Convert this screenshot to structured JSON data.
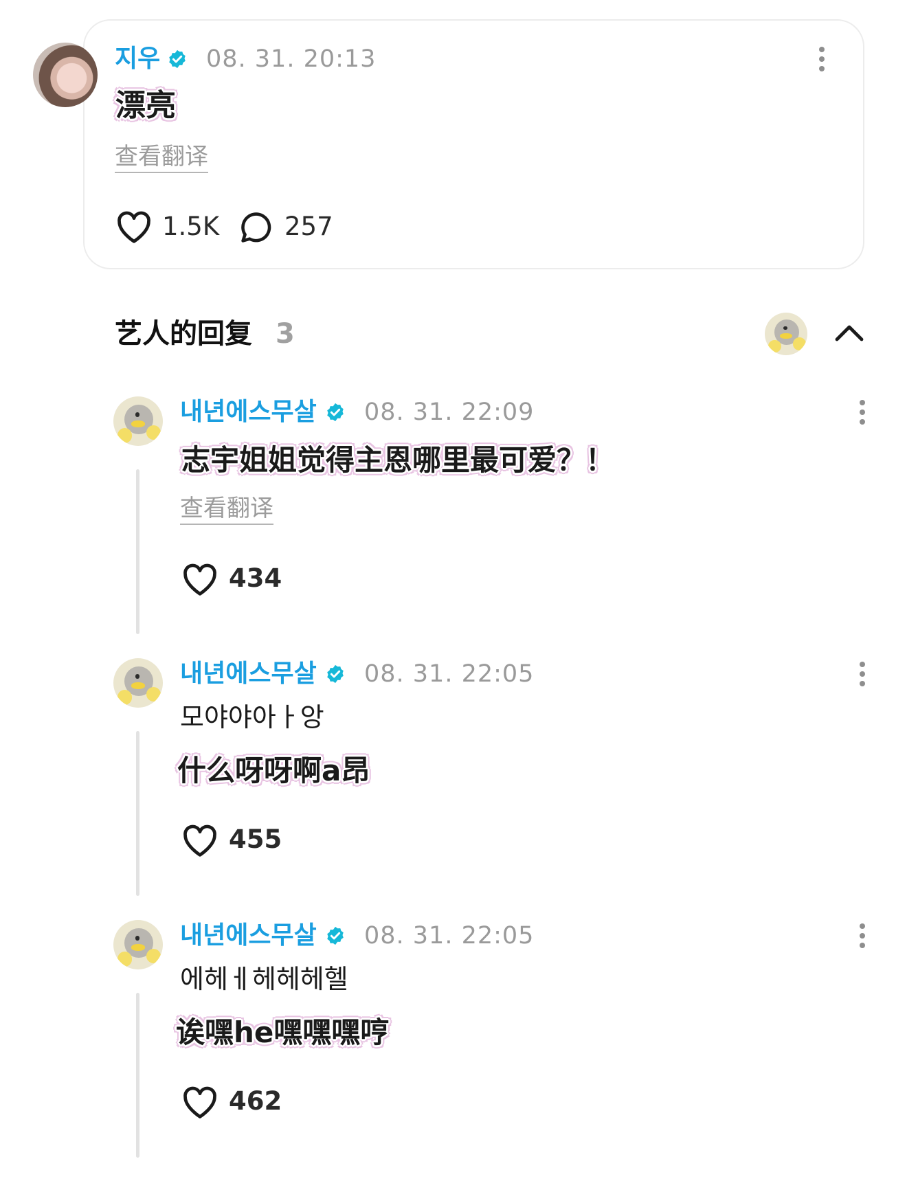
{
  "main_comment": {
    "author": "지우",
    "time": "08. 31. 20:13",
    "text": "漂亮",
    "translate_label": "查看翻译",
    "likes": "1.5K",
    "replies_count": "257"
  },
  "replies_section": {
    "title": "艺人的回复",
    "count": "3"
  },
  "replies": [
    {
      "author": "내년에스무살",
      "time": "08. 31. 22:09",
      "text": "",
      "caption": "志宇姐姐觉得主恩哪里最可爱？！",
      "translate_label": "查看翻译",
      "likes": "434"
    },
    {
      "author": "내년에스무살",
      "time": "08. 31. 22:05",
      "text": "모야야아ㅏ앙",
      "caption": "什么呀呀啊a昂",
      "likes": "455"
    },
    {
      "author": "내년에스무살",
      "time": "08. 31. 22:05",
      "text": "에헤ㅔ헤헤헤헬",
      "caption": "诶嘿he嘿嘿嘿哼",
      "likes": "462"
    }
  ],
  "colors": {
    "accent_name": "#1a9ee0",
    "verified_badge": "#16b8d8",
    "caption_outline": "#e8c4e2"
  }
}
